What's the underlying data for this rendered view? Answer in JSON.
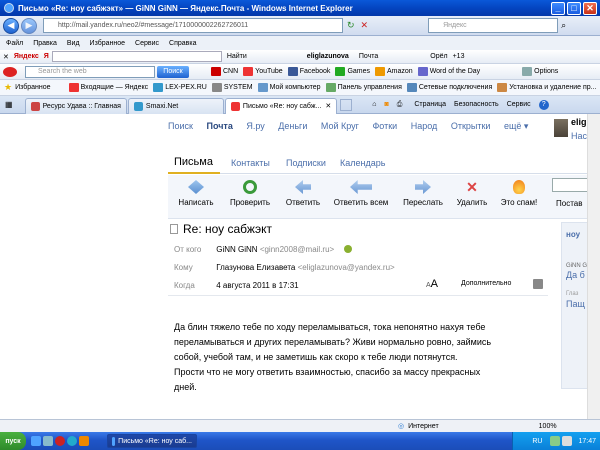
{
  "window": {
    "title": "Письмо «Re: ноу сабжэкт» — GiNN GiNN — Яндекс.Почта - Windows Internet Explorer",
    "url": "http://mail.yandex.ru/neo2/#message/1710000002262726011",
    "search_engine": "Яндекс"
  },
  "menubar": [
    "Файл",
    "Правка",
    "Вид",
    "Избранное",
    "Сервис",
    "Справка"
  ],
  "yandex_toolbar": {
    "logo": "Яндекс",
    "find": "Найти",
    "user": "eliglazunova",
    "items": [
      "Почта",
      "Орёл",
      "+13"
    ]
  },
  "google_toolbar": {
    "search_placeholder": "Search the web",
    "search_button": "Поиск",
    "items": [
      "CNN",
      "YouTube",
      "Facebook",
      "Games",
      "Amazon",
      "Word of the Day"
    ],
    "options": "Options"
  },
  "favorites_bar": {
    "label": "Избранное",
    "items": [
      "Входящие — Яндекс",
      "LEX-PEX.RU",
      "SYSTEM",
      "Мой компьютер",
      "Панель управления",
      "Сетевые подключения",
      "Установка и удаление пр..."
    ]
  },
  "tabs": {
    "items": [
      "Ресурс Удава :: Главная",
      "Smaxi.Net",
      "Письмо «Re: ноу сабж..."
    ],
    "right": [
      "Страница",
      "Безопасность",
      "Сервис"
    ]
  },
  "mail": {
    "topnav": [
      "Поиск",
      "Почта",
      "Я.ру",
      "Деньги",
      "Мой Круг",
      "Фотки",
      "Народ",
      "Открытки",
      "ещё ▾"
    ],
    "user_short": "elig",
    "user_settings": "Нас",
    "sections": [
      "Письма",
      "Контакты",
      "Подписки",
      "Календарь"
    ],
    "actions": [
      "Написать",
      "Проверить",
      "Ответить",
      "Ответить всем",
      "Переслать",
      "Удалить",
      "Это спам!"
    ],
    "post_label": "Постав",
    "subject": "Re: ноу сабжэкт",
    "from_label": "От кого",
    "from_name": "GiNN GiNN",
    "from_email": "<ginn2008@mail.ru>",
    "to_label": "Кому",
    "to_name": "Глазунова Елизавета",
    "to_email": "<eliglazunova@yandex.ru>",
    "when_label": "Когда",
    "date": "4 августа 2011 в 17:31",
    "font_small": "A",
    "font_big": "A",
    "details": "Дополнительно",
    "body": [
      "Да блин тяжело тебе по ходу переламываться, тока непонятно нахуя тебе",
      "переламываться и других переламывать? Живи нормально ровно, займись",
      "собой, учебой там, и не заметишь как скоро к тебе люди потянутся.",
      "Прости что не могу ответить взаимностью, спасибо за массу прекрасных",
      "дней."
    ],
    "right_panel": {
      "title": "ноу",
      "r1_small": "GiNN G",
      "r1_text": "Да б",
      "r2_small": "Глаз",
      "r2_text": "Пащ"
    }
  },
  "status": {
    "zone": "Интернет",
    "zoom": "100%"
  },
  "taskbar": {
    "start": "пуск",
    "task": "Письмо «Re: ноу саб...",
    "lang": "RU",
    "time": "17:47"
  }
}
